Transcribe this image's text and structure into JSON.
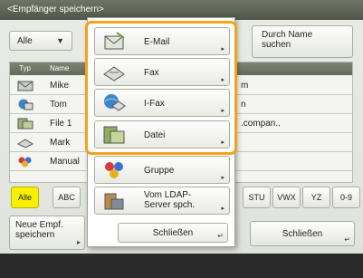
{
  "title": "<Empfänger speichern>",
  "filter": {
    "selected": "Alle"
  },
  "search_button": {
    "line1": "Durch Name",
    "line2": "suchen"
  },
  "table": {
    "headers": {
      "type": "Typ",
      "name": "Name"
    },
    "rows": [
      {
        "name": "Mike",
        "extra": "m",
        "icon": "email-icon"
      },
      {
        "name": "Tom",
        "extra": "n",
        "icon": "ifax-icon"
      },
      {
        "name": "File 1",
        "extra": ".compan..",
        "icon": "file-icon"
      },
      {
        "name": "Mark",
        "extra": "",
        "icon": "fax-icon"
      },
      {
        "name": "Manual",
        "extra": "",
        "icon": "group-icon"
      }
    ]
  },
  "tabs": [
    "Alle",
    "ABC",
    "STU",
    "VWX",
    "YZ",
    "0-9"
  ],
  "new_button": {
    "line1": "Neue Empf.",
    "line2": "speichern"
  },
  "close_label": "Schließen",
  "popup": {
    "items": [
      {
        "label": "E-Mail",
        "icon": "email-icon"
      },
      {
        "label": "Fax",
        "icon": "fax-icon"
      },
      {
        "label": "I-Fax",
        "icon": "ifax-icon"
      },
      {
        "label": "Datei",
        "icon": "file-icon"
      },
      {
        "label": "Gruppe",
        "icon": "group-icon"
      },
      {
        "label_line1": "Vom LDAP-",
        "label_line2": "Server spch.",
        "icon": "ldap-icon"
      }
    ],
    "close_label": "Schließen"
  },
  "colors": {
    "highlight": "#f3a21a",
    "active_tab": "#f7f000",
    "title_bar": "#5e6455"
  }
}
